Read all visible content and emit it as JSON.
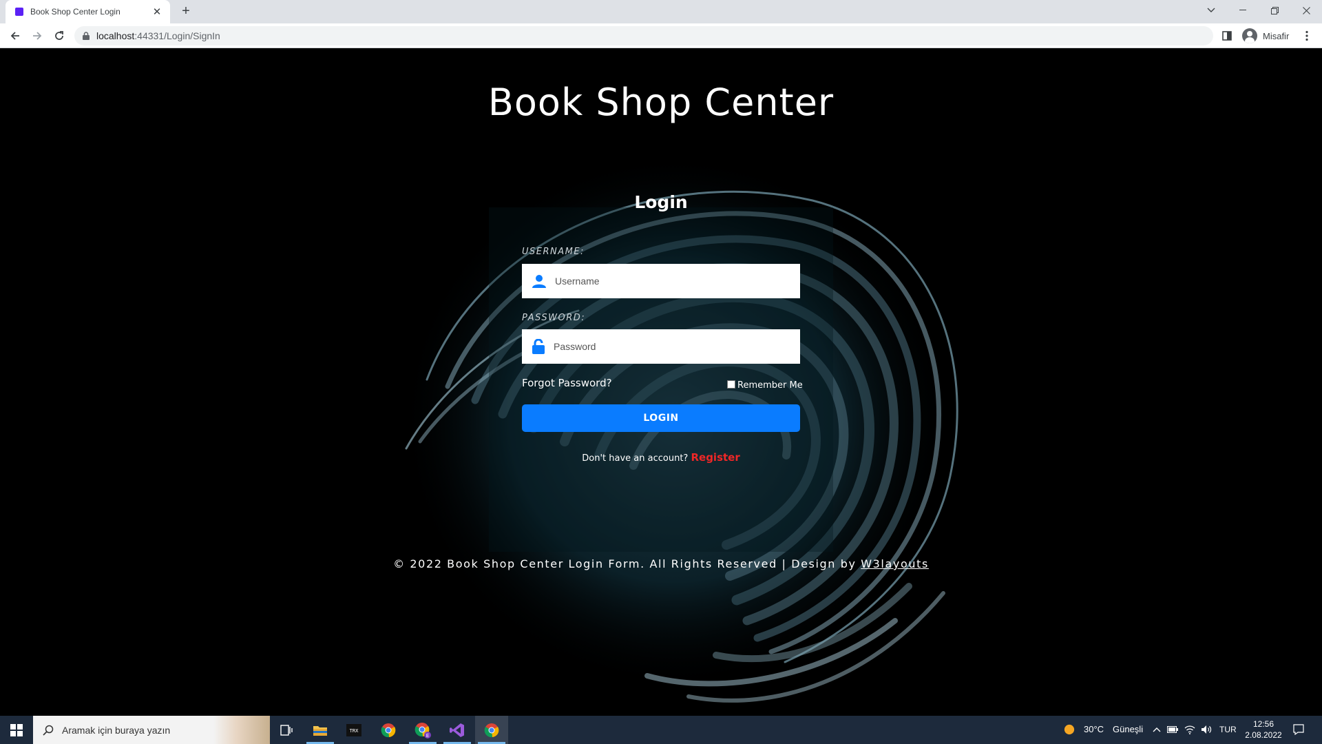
{
  "browser": {
    "tab_title": "Book Shop Center Login",
    "tab_close": "✕",
    "new_tab": "+",
    "url_host": "localhost",
    "url_path": ":44331/Login/SignIn",
    "profile_name": "Misafir"
  },
  "page": {
    "site_title": "Book Shop Center",
    "login_heading": "Login",
    "username_label": "USERNAME:",
    "username_placeholder": "Username",
    "password_label": "PASSWORD:",
    "password_placeholder": "Password",
    "forgot_password": "Forgot Password?",
    "remember_me": "Remember Me",
    "login_button": "LOGIN",
    "no_account_text": "Don't have an account?",
    "register_link": "Register",
    "footer_text": "© 2022 Book Shop Center Login Form. All Rights Reserved | Design by ",
    "footer_link": "W3layouts",
    "accent_color": "#0a7cff",
    "register_color": "#ef2727"
  },
  "taskbar": {
    "search_placeholder": "Aramak için buraya yazın",
    "weather_temp": "30°C",
    "weather_desc": "Güneşli",
    "language": "TUR",
    "time": "12:56",
    "date": "2.08.2022",
    "apps": [
      "task-view-icon",
      "file-explorer-icon",
      "terminal-icon",
      "chrome-icon",
      "chrome-profile-icon",
      "visual-studio-icon",
      "chrome-active-icon"
    ]
  }
}
